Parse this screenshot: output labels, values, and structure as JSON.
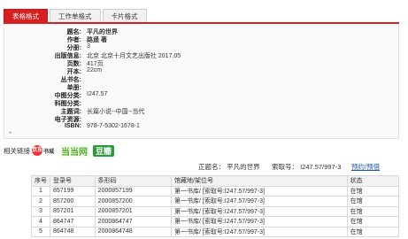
{
  "tabs": [
    "表格格式",
    "工作单格式",
    "卡片格式"
  ],
  "record": [
    {
      "label": "题名:",
      "value": "平凡的世界",
      "bold": true
    },
    {
      "label": "作者:",
      "value": "路遥 著",
      "bold": true
    },
    {
      "label": "分册:",
      "value": "3"
    },
    {
      "label": "出版信息:",
      "value": "北京   北京十月文艺出版社  2017.05"
    },
    {
      "label": "页数:",
      "value": "417页"
    },
    {
      "label": "开本:",
      "value": "22cm"
    },
    {
      "label": "丛书名:",
      "value": ""
    },
    {
      "label": "单册:",
      "value": ""
    },
    {
      "label": "中图分类:",
      "value": "I247.57"
    },
    {
      "label": "科图分类:",
      "value": ""
    },
    {
      "label": "主题词:",
      "value": "长篇小说--中国--当代"
    },
    {
      "label": "电子资源:",
      "value": ""
    },
    {
      "label": "ISBN:",
      "value": "978-7-5302-1678-1"
    }
  ],
  "related": {
    "label": "相关链接",
    "jd": "京东",
    "jd_sub": "书城",
    "dangdang": "当当网",
    "douban": "豆瓣"
  },
  "callline": {
    "title": "正题名： 平凡的世界",
    "callno": "索取号： I247.57/997-3",
    "action": "预约/预借"
  },
  "table": {
    "headers": [
      "序号",
      "登录号",
      "条形码",
      "馆藏地/架位号",
      "状态"
    ],
    "rows": [
      [
        "1",
        "857199",
        "2000857199",
        "第一书库/ [索取号:I247.57/997-3]",
        "在馆"
      ],
      [
        "2",
        "857200",
        "2000857200",
        "第一书库/ [索取号:I247.57/997-3]",
        "在馆"
      ],
      [
        "3",
        "857201",
        "2000857201",
        "第一书库/ [索取号:I247.57/997-3]",
        "在馆"
      ],
      [
        "4",
        "864747",
        "2000864747",
        "第一书库/ [索取号:I247.57/997-3]",
        "在馆"
      ],
      [
        "5",
        "864748",
        "2000864748",
        "第一书库/ [索取号:I247.57/997-3]",
        "在馆"
      ]
    ]
  }
}
